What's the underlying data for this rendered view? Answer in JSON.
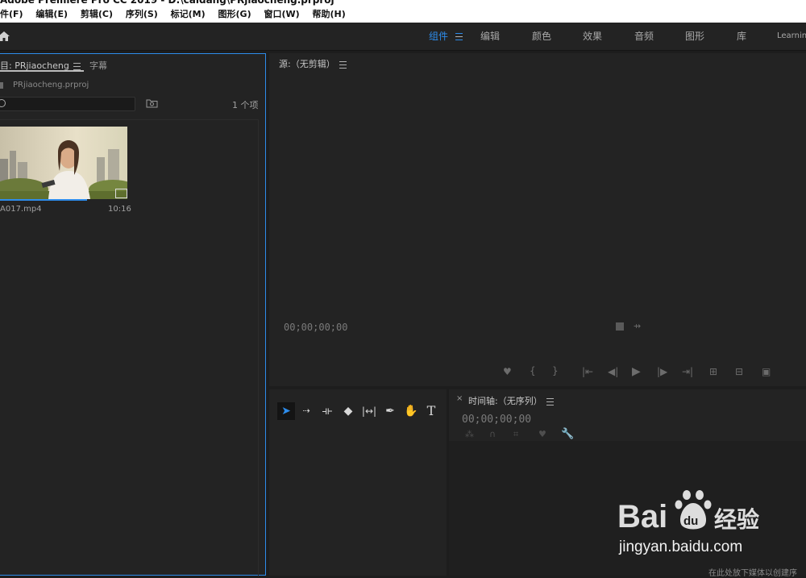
{
  "title": "Adobe Premiere Pro CC 2019 - D:\\caidang\\PRjiaocheng.prproj",
  "menu": [
    "件(F)",
    "编辑(E)",
    "剪辑(C)",
    "序列(S)",
    "标记(M)",
    "图形(G)",
    "窗口(W)",
    "帮助(H)"
  ],
  "workspaces": [
    {
      "label": "组件",
      "active": true
    },
    {
      "label": "编辑"
    },
    {
      "label": "颜色"
    },
    {
      "label": "效果"
    },
    {
      "label": "音频"
    },
    {
      "label": "图形"
    },
    {
      "label": "库"
    },
    {
      "label": "Learning"
    }
  ],
  "project": {
    "tab_label": "目: PRjiaocheng",
    "captions_tab": "字幕",
    "file_name": "PRjiaocheng.prproj",
    "search_placeholder": "",
    "item_count": "1 个项",
    "clip": {
      "name": "A017.mp4",
      "duration": "10:16"
    }
  },
  "source": {
    "title": "源:（无剪辑）",
    "timecode": "00;00;00;00"
  },
  "timeline": {
    "title": "时间轴:（无序列）",
    "timecode": "00;00;00;00",
    "close": "×"
  },
  "tools": [
    "selection-tool",
    "track-select-tool",
    "ripple-edit-tool",
    "razor-tool",
    "slip-tool",
    "pen-tool",
    "hand-tool",
    "type-tool"
  ],
  "watermark": {
    "logo": "Bai du 经验",
    "url": "jingyan.baidu.com"
  },
  "hint_text": "在此处放下媒体以创建序"
}
